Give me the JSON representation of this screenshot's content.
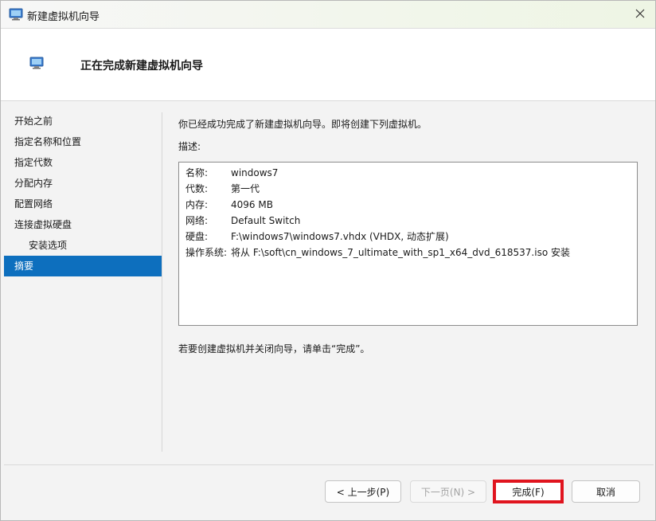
{
  "window": {
    "title": "新建虚拟机向导",
    "icon": "vm-wizard-icon",
    "close_icon": "close-icon"
  },
  "header": {
    "title": "正在完成新建虚拟机向导"
  },
  "sidebar": {
    "items": [
      {
        "label": "开始之前"
      },
      {
        "label": "指定名称和位置"
      },
      {
        "label": "指定代数"
      },
      {
        "label": "分配内存"
      },
      {
        "label": "配置网络"
      },
      {
        "label": "连接虚拟硬盘"
      },
      {
        "label": "安装选项"
      },
      {
        "label": "摘要"
      }
    ],
    "active_color": "#0d6fbe"
  },
  "main": {
    "intro": "你已经成功完成了新建虚拟机向导。即将创建下列虚拟机。",
    "description_label": "描述:",
    "summary": [
      {
        "key": "名称:",
        "value": "windows7"
      },
      {
        "key": "代数:",
        "value": "第一代"
      },
      {
        "key": "内存:",
        "value": "4096 MB"
      },
      {
        "key": "网络:",
        "value": "Default Switch"
      },
      {
        "key": "硬盘:",
        "value": "F:\\windows7\\windows7.vhdx (VHDX, 动态扩展)"
      },
      {
        "key": "操作系统:",
        "value": "将从 F:\\soft\\cn_windows_7_ultimate_with_sp1_x64_dvd_618537.iso 安装"
      }
    ],
    "footer_note": "若要创建虚拟机并关闭向导，请单击“完成”。"
  },
  "buttons": {
    "previous": "< 上一步(P)",
    "next": "下一页(N) >",
    "finish": "完成(F)",
    "cancel": "取消"
  },
  "colors": {
    "highlight_border": "#e0141e"
  }
}
